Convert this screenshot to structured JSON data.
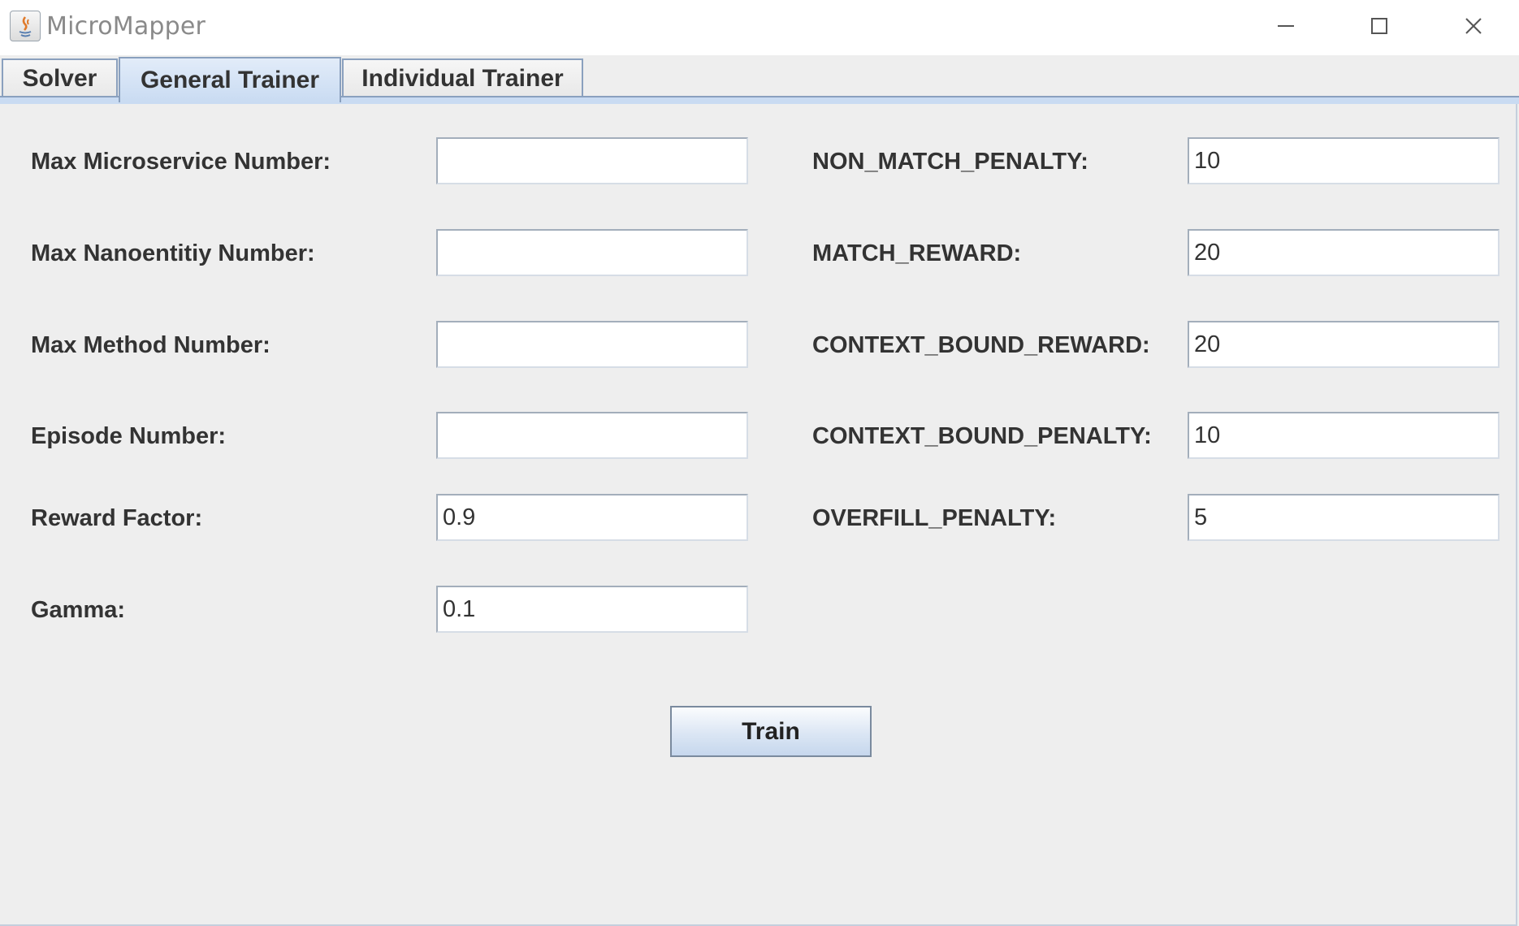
{
  "window": {
    "title": "MicroMapper",
    "controls": {
      "minimize": "minimize-icon",
      "maximize": "maximize-icon",
      "close": "close-icon"
    }
  },
  "tabs": [
    {
      "label": "Solver",
      "active": false
    },
    {
      "label": "General Trainer",
      "active": true
    },
    {
      "label": "Individual Trainer",
      "active": false
    }
  ],
  "form": {
    "left": [
      {
        "label": "Max Microservice Number:",
        "value": ""
      },
      {
        "label": "Max Nanoentitiy Number:",
        "value": ""
      },
      {
        "label": "Max Method Number:",
        "value": ""
      },
      {
        "label": "Episode Number:",
        "value": ""
      },
      {
        "label": "Reward Factor:",
        "value": "0.9"
      },
      {
        "label": "Gamma:",
        "value": "0.1"
      }
    ],
    "right": [
      {
        "label": "NON_MATCH_PENALTY:",
        "value": "10"
      },
      {
        "label": "MATCH_REWARD:",
        "value": "20"
      },
      {
        "label": "CONTEXT_BOUND_REWARD:",
        "value": "20"
      },
      {
        "label": "CONTEXT_BOUND_PENALTY:",
        "value": "10"
      },
      {
        "label": "OVERFILL_PENALTY:",
        "value": "5"
      }
    ]
  },
  "train_button": {
    "label": "Train"
  },
  "colors": {
    "background": "#eeeeee",
    "tab_active": "#c9dbf2",
    "border": "#8aa0be"
  }
}
